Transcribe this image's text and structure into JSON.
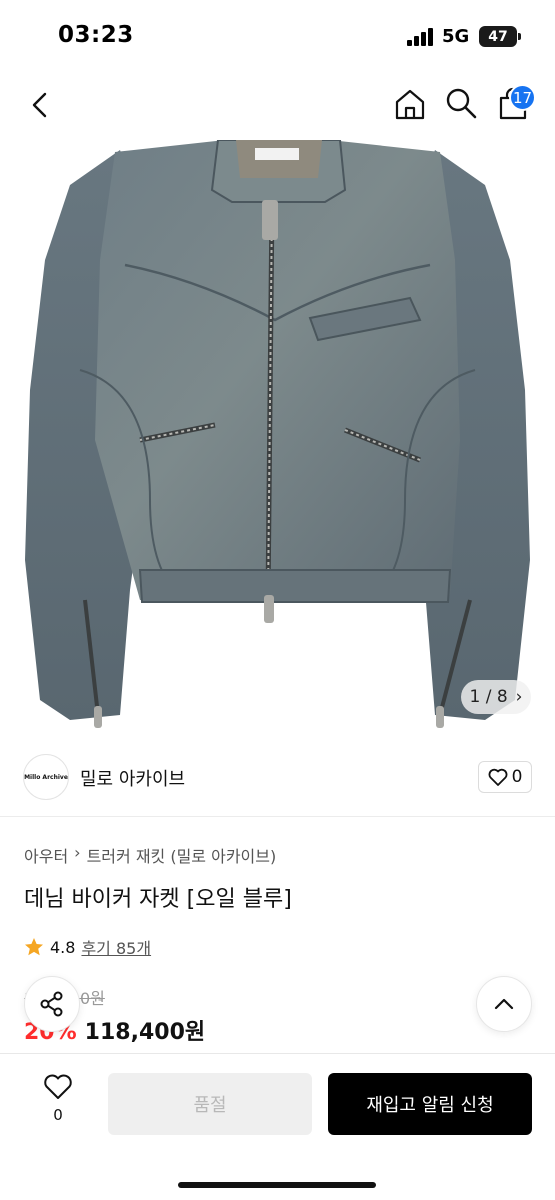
{
  "status_bar": {
    "time": "03:23",
    "network": "5G",
    "battery": "47"
  },
  "nav": {
    "cart_count": "17",
    "icons": [
      "chevron-left-icon",
      "home-icon",
      "search-icon",
      "shopping-bag-icon"
    ]
  },
  "gallery": {
    "counter": "1 / 8",
    "image": "denim-biker-jacket"
  },
  "brand": {
    "logo_text": "Millo Archive",
    "name": "밀로 아카이브",
    "like_count": "0"
  },
  "product": {
    "breadcrumb": [
      "아우터",
      "트러커 재킷 (밀로 아카이브)"
    ],
    "title": "데님 바이커 자켓 [오일 블루]",
    "rating": "4.8",
    "reviews": "후기 85개",
    "original_price": "148,000원",
    "discount": "20%",
    "price": "118,400원"
  },
  "bottom_bar": {
    "wish_count": "0",
    "soldout_label": "품절",
    "restock_label": "재입고 알림 신청"
  },
  "colors": {
    "accent": "#1673f1",
    "discount": "#ff2d2d",
    "star": "#f5a623",
    "primary_button": "#000000"
  }
}
